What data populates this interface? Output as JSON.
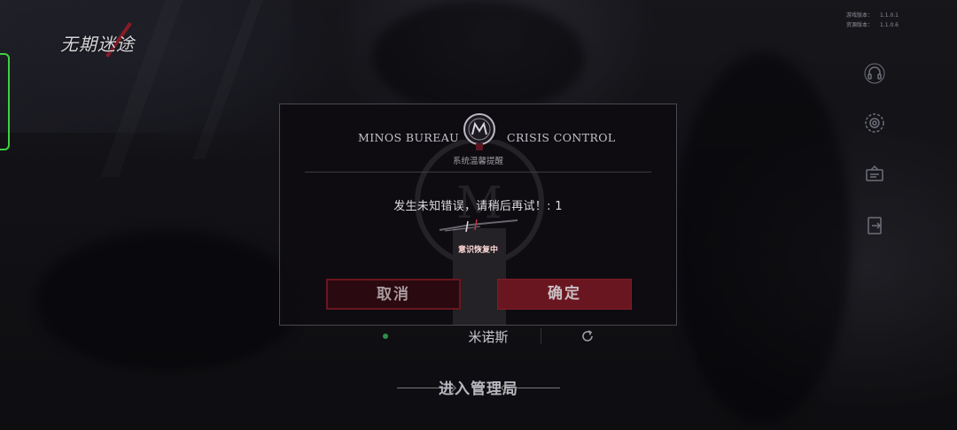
{
  "app": {
    "logo_text": "无期迷途",
    "version_lines": [
      {
        "label": "游戏版本：",
        "value": "1.1.0.1"
      },
      {
        "label": "资源版本：",
        "value": "1.1.0.6"
      }
    ]
  },
  "right_icons": [
    "headset-icon",
    "gear-icon",
    "notice-board-icon",
    "logout-icon"
  ],
  "server": {
    "status_color": "#2f8f4a",
    "name": "米诺斯",
    "refresh_icon": "refresh-icon"
  },
  "enter": {
    "label": "进入管理局"
  },
  "dialog": {
    "header_left": "MINOS BUREAU",
    "header_right": "CRISIS CONTROL",
    "subtitle": "系统温馨提醒",
    "message": "发生未知错误，请稍后再试！: 1",
    "recovery_text": "意识恢复中",
    "cancel_label": "取消",
    "ok_label": "确定"
  },
  "colors": {
    "accent_red": "#6a1620",
    "status_green": "#3fd13f"
  }
}
